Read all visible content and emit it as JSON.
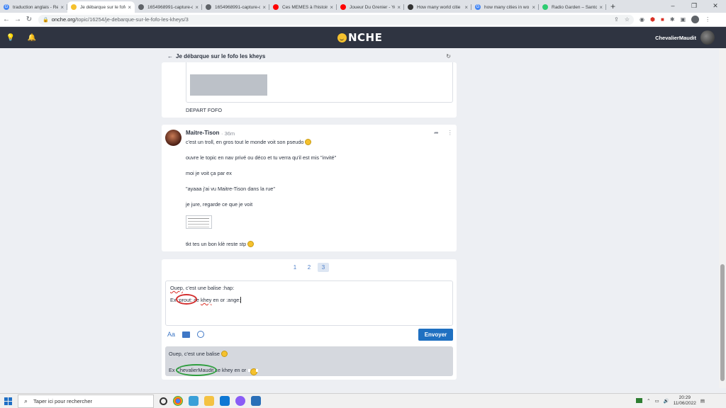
{
  "tabs": [
    {
      "title": "traduction anglais - Re",
      "fav": "G",
      "color": "#4285f4",
      "active": false
    },
    {
      "title": "Je débarque sur le fofo",
      "fav": "",
      "color": "#f5c12e",
      "active": true
    },
    {
      "title": "1654968991-capture-d",
      "fav": "",
      "color": "#5f6368",
      "active": false
    },
    {
      "title": "1654968991-capture-d",
      "fav": "",
      "color": "#5f6368",
      "active": false
    },
    {
      "title": "Ces MEMES à l'histoire",
      "fav": "",
      "color": "#ff0000",
      "active": false
    },
    {
      "title": "Joueur Du Grenier - Yo",
      "fav": "",
      "color": "#ff0000",
      "active": false
    },
    {
      "title": "How many world citie",
      "fav": "",
      "color": "#333333",
      "active": false
    },
    {
      "title": "how many cities in wo",
      "fav": "G",
      "color": "#4285f4",
      "active": false
    },
    {
      "title": "Radio Garden – Santo",
      "fav": "",
      "color": "#2ecc71",
      "active": false
    }
  ],
  "browser": {
    "url_host": "onche.org",
    "url_path": "/topic/16254/je-debarque-sur-le-fofo-les-kheys/3"
  },
  "site": {
    "logo": "NCHE",
    "username": "ChevalierMaudit"
  },
  "topic": {
    "title": "Je débarque sur le fofo les kheys"
  },
  "prev_post": {
    "text": "DEPART FOFO"
  },
  "post": {
    "author": "Maitre-Tison",
    "time": "· 36m",
    "lines": [
      "c'est un troll, en gros tout le monde voit son pseudo",
      "ouvre le topic en nav privé ou déco et tu verra qu'il est mis \"invité\"",
      "moi je voit ça par ex",
      "\"ayaaa j'ai vu Maitre-Tison dans la rue\"",
      "je jure, regarde ce que je voit",
      "tkt tes un bon klè reste stp"
    ]
  },
  "pagination": [
    "1",
    "2",
    "3"
  ],
  "editor": {
    "line1_a": "Ouep",
    "line1_b": ", c'est une balise :hap:",
    "line2_a": "Ex ",
    "line2_tag": ":prout:",
    "line2_b": " ce ",
    "line2_c": "khey",
    "line2_d": " en or :ange:",
    "send": "Envoyer",
    "font_icon": "Aa"
  },
  "preview": {
    "line1": "Ouep, c'est une balise",
    "line2_a": "Ex ",
    "line2_name": "ChevalierMaudit",
    "line2_b": " ce khey en or"
  },
  "taskbar": {
    "search_placeholder": "Taper ici pour rechercher",
    "time": "20:29",
    "date": "11/06/2022"
  }
}
